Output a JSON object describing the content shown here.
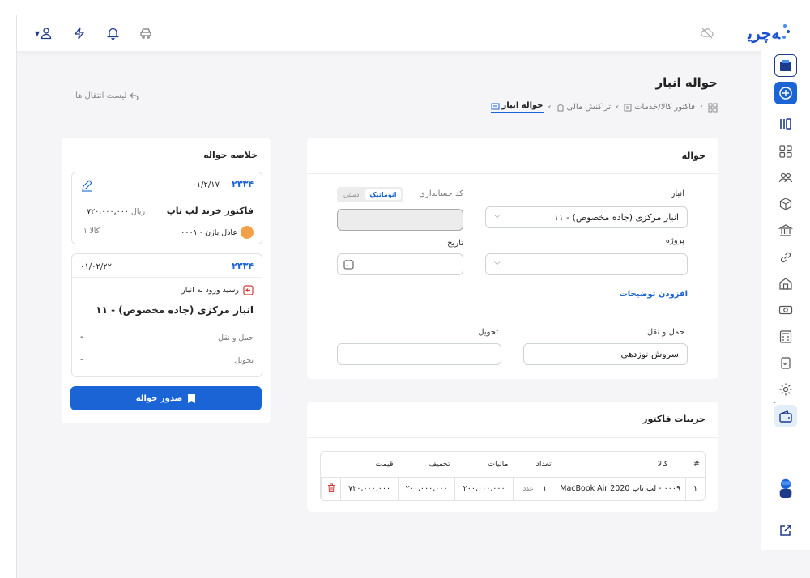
{
  "topbar": {
    "logo_text": "ﻪﭼﺮﻳ",
    "icons": [
      "user-icon",
      "flash-icon",
      "bell-icon",
      "car-icon",
      "cloud-off-icon"
    ]
  },
  "sidebar": {
    "badge": "۲"
  },
  "page": {
    "title": "حواله انبار",
    "back_label": "لیست انتقال ها",
    "breadcrumb": [
      "فاکتور کالا/خدمات",
      "تراکنش مالی",
      "حواله انبار"
    ]
  },
  "form": {
    "section_title": "حواله",
    "warehouse_label": "انبار",
    "warehouse_value": "۱۱ - انبار مرکزی (جاده مخصوص)",
    "accounting_code_label": "کد حسابداری",
    "toggle_auto": "اتوماتیک",
    "toggle_manual": "دستی",
    "project_label": "پروژه",
    "date_label": "تاریخ",
    "add_description": "افزودن توضیحات",
    "transport_label": "حمل و نقل",
    "transport_value": "سروش نوزدهی",
    "delivery_label": "تحویل"
  },
  "invoice": {
    "section_title": "جزییات فاکتور",
    "headers": [
      "#",
      "کالا",
      "تعداد",
      "مالیات",
      "تخفیف",
      "قیمت"
    ],
    "rows": [
      {
        "index": "۱",
        "product": "۰۰۰۹ - لپ تاپ MacBook Air 2020",
        "qty": "۱",
        "unit": "عدد",
        "tax": "۲۰۰,۰۰۰,۰۰۰",
        "discount": "۲۰۰,۰۰۰,۰۰۰",
        "price": "۷۲۰,۰۰۰,۰۰۰"
      }
    ]
  },
  "summary": {
    "title": "خلاصه حواله",
    "invoice_card": {
      "number": "۲۳۳۴",
      "date": "۰۱/۲/۱۷",
      "title": "فاکتور خرید لپ تاپ",
      "amount": "۷۲۰,۰۰۰,۰۰۰",
      "currency": "ریال",
      "person": "۰۰۰۱ - عادل باژن",
      "count": "۱ کالا"
    },
    "receipt_card": {
      "number": "۲۳۳۴",
      "date": "۰۱/۰۲/۲۲",
      "type": "رسید ورود به انبار",
      "warehouse": "۱۱ - انبار مرکزی (جاده مخصوص)",
      "transport_label": "حمل و نقل",
      "transport_value": "-",
      "delivery_label": "تحویل",
      "delivery_value": "-"
    },
    "issue_button": "صدور حواله"
  },
  "colors": {
    "primary": "#1a64d6",
    "danger": "#d23b3b"
  }
}
